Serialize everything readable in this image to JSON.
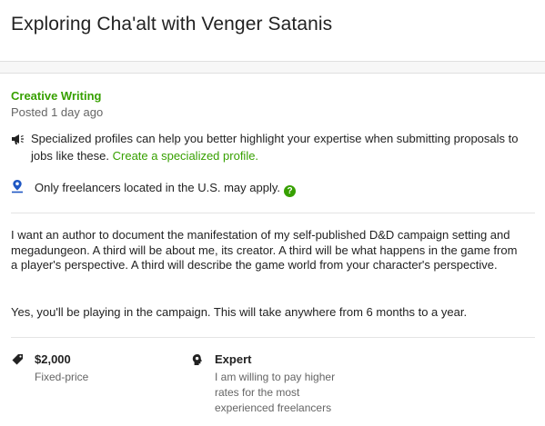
{
  "job": {
    "title": "Exploring Cha'alt with Venger Satanis",
    "category": "Creative Writing",
    "posted": "Posted 1 day ago"
  },
  "notice": {
    "icon": "megaphone-icon",
    "text": "Specialized profiles can help you better highlight your expertise when submitting proposals to jobs like these.",
    "link": "Create a specialized profile."
  },
  "location": {
    "icon": "location-pin-icon",
    "text": "Only freelancers located in the U.S. may apply.",
    "help": "?"
  },
  "description": {
    "p1": "I want an author to document the manifestation of my self-published D&D campaign setting and megadungeon. A third will be about me, its creator. A third will be what happens in the game from a player's perspective. A third will describe the game world from your character's perspective.",
    "p2": "Yes, you'll be playing in the campaign. This will take anywhere from 6 months to a year."
  },
  "stats": {
    "price": {
      "icon": "price-tag-icon",
      "value": "$2,000",
      "label": "Fixed-price"
    },
    "level": {
      "icon": "expert-head-icon",
      "value": "Expert",
      "label": "I am willing to pay higher rates for the most experienced freelancers"
    }
  },
  "colors": {
    "accent": "#37a000",
    "text": "#222222",
    "muted": "#656565"
  }
}
